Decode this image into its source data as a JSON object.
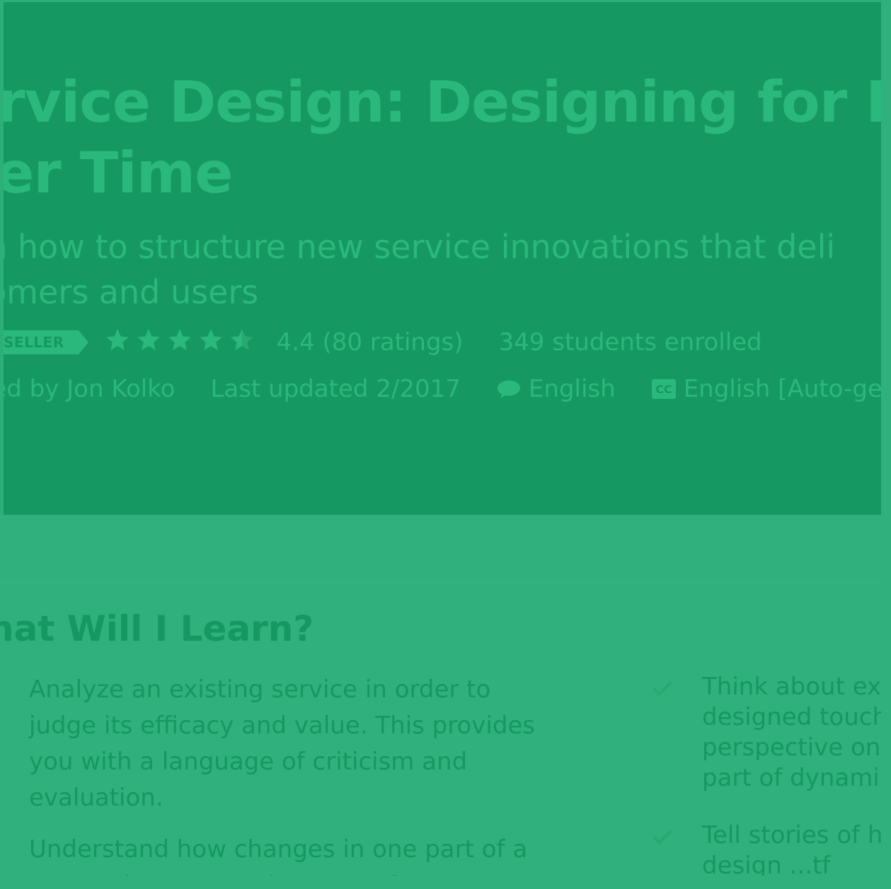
{
  "hero": {
    "title_line1": "ervice Design: Designing for Ex",
    "title_line2": "ver Time",
    "subtitle_line1": "rn how to structure new service innovations that deli",
    "subtitle_line2": "tomers and users",
    "badge": "SELLER",
    "rating": "4.4 (80 ratings)",
    "stars_filled": 4.5,
    "enrolled": "349 students enrolled",
    "created_by": "ted by Jon Kolko",
    "last_updated": "Last updated 2/2017",
    "language": "English",
    "captions": "English [Auto-ge",
    "speech-icon": "speech-bubble-icon",
    "cc-icon": "closed-captions-icon"
  },
  "learn": {
    "title": "hat Will I Learn?",
    "left_items": [
      "Analyze an existing service in order to judge its efficacy and value. This provides you with a language of criticism and evaluation.",
      "Understand how changes in one part of a system impact another part of a system"
    ],
    "right_items": [
      [
        "Think about ex",
        "designed touch",
        "perspective on",
        "part of dynami"
      ],
      [
        "Tell stories of h",
        "design ...tf"
      ]
    ]
  },
  "colors": {
    "hero_bg": "#169862",
    "page_bg": "#2fb07c",
    "accent_text": "#2bb87c"
  }
}
